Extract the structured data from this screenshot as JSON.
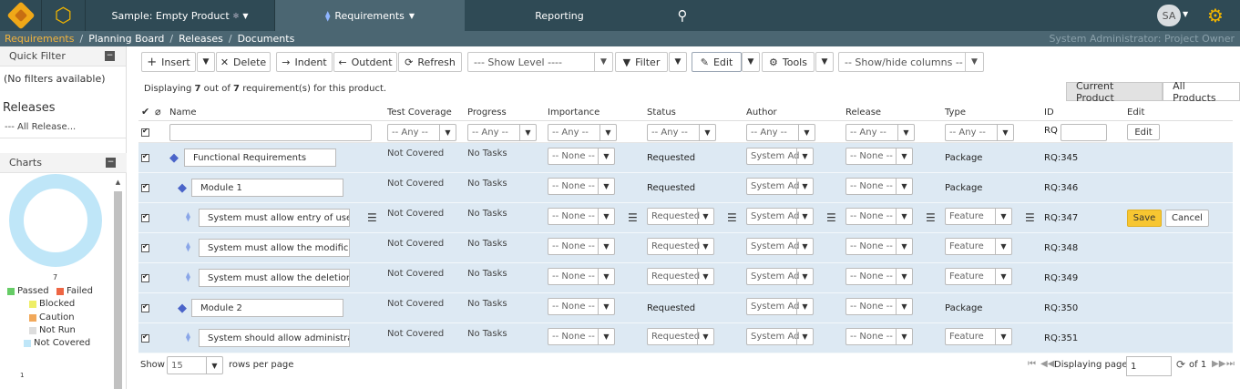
{
  "topnav": {
    "product": "Sample: Empty Product",
    "requirements_tab": "Requirements",
    "reporting_tab": "Reporting",
    "avatar_initials": "SA"
  },
  "breadcrumbs": [
    "Requirements",
    "Planning Board",
    "Releases",
    "Documents"
  ],
  "user_role": "System Administrator: Project Owner",
  "sidebar": {
    "quick_filter_title": "Quick Filter",
    "no_filters": "(No filters available)",
    "releases_title": "Releases",
    "all_releases": "--- All Release...",
    "charts_title": "Charts",
    "donut_value": "7",
    "axis_value": "1",
    "legend": {
      "passed": "Passed",
      "failed": "Failed",
      "blocked": "Blocked",
      "caution": "Caution",
      "not_run": "Not Run",
      "not_covered": "Not Covered"
    },
    "colors": {
      "passed": "#66cc66",
      "failed": "#ee6644",
      "blocked": "#eeee66",
      "caution": "#f1a85a",
      "not_run": "#dddddd",
      "not_covered": "#bfe6f8"
    }
  },
  "toolbar": {
    "insert": "Insert",
    "delete": "Delete",
    "indent": "Indent",
    "outdent": "Outdent",
    "refresh": "Refresh",
    "show_level": "--- Show Level ----",
    "filter": "Filter",
    "edit": "Edit",
    "tools": "Tools",
    "show_hide_columns": "-- Show/hide columns --"
  },
  "displaying": {
    "prefix": "Displaying ",
    "shown": "7",
    "middle": " out of ",
    "total": "7",
    "suffix": " requirement(s) for this product."
  },
  "product_switch": {
    "current": "Current Product",
    "all": "All Products"
  },
  "columns": {
    "name": "Name",
    "test_coverage": "Test Coverage",
    "progress": "Progress",
    "importance": "Importance",
    "status": "Status",
    "author": "Author",
    "release": "Release",
    "type": "Type",
    "id": "ID",
    "edit": "Edit"
  },
  "filters": {
    "any": "-- Any --",
    "rq_prefix": "RQ",
    "edit_button": "Edit"
  },
  "rows": [
    {
      "name": "Functional Requirements",
      "coverage": "Not Covered",
      "progress": "No Tasks",
      "importance": "-- None --",
      "status": "Requested",
      "author": "System Administrator",
      "release": "-- None --",
      "type": "Package",
      "id": "RQ:345"
    },
    {
      "name": "Module 1",
      "coverage": "Not Covered",
      "progress": "No Tasks",
      "importance": "-- None --",
      "status": "Requested",
      "author": "System Administrator",
      "release": "-- None --",
      "type": "Package",
      "id": "RQ:346"
    },
    {
      "name": "System must allow entry of users",
      "coverage": "Not Covered",
      "progress": "No Tasks",
      "importance": "-- None --",
      "status": "Requested",
      "author": "System Administrator",
      "release": "-- None --",
      "type": "Feature",
      "id": "RQ:347",
      "save": "Save",
      "cancel": "Cancel"
    },
    {
      "name": "System must allow the modification of users",
      "coverage": "Not Covered",
      "progress": "No Tasks",
      "importance": "-- None --",
      "status": "Requested",
      "author": "System Administrator",
      "release": "-- None --",
      "type": "Feature",
      "id": "RQ:348"
    },
    {
      "name": "System must allow the deletion of users",
      "coverage": "Not Covered",
      "progress": "No Tasks",
      "importance": "-- None --",
      "status": "Requested",
      "author": "System Administrator",
      "release": "-- None --",
      "type": "Feature",
      "id": "RQ:349"
    },
    {
      "name": "Module 2",
      "coverage": "Not Covered",
      "progress": "No Tasks",
      "importance": "-- None --",
      "status": "Requested",
      "author": "System Administrator",
      "release": "-- None --",
      "type": "Package",
      "id": "RQ:350"
    },
    {
      "name": "System should allow administrators",
      "coverage": "Not Covered",
      "progress": "No Tasks",
      "importance": "-- None --",
      "status": "Requested",
      "author": "System Administrator",
      "release": "-- None --",
      "type": "Feature",
      "id": "RQ:351"
    }
  ],
  "footer": {
    "show": "Show",
    "rows_per_page_value": "15",
    "rows_per_page": "rows per page",
    "displaying_page": "Displaying page",
    "page_value": "1",
    "of": "of 1"
  }
}
